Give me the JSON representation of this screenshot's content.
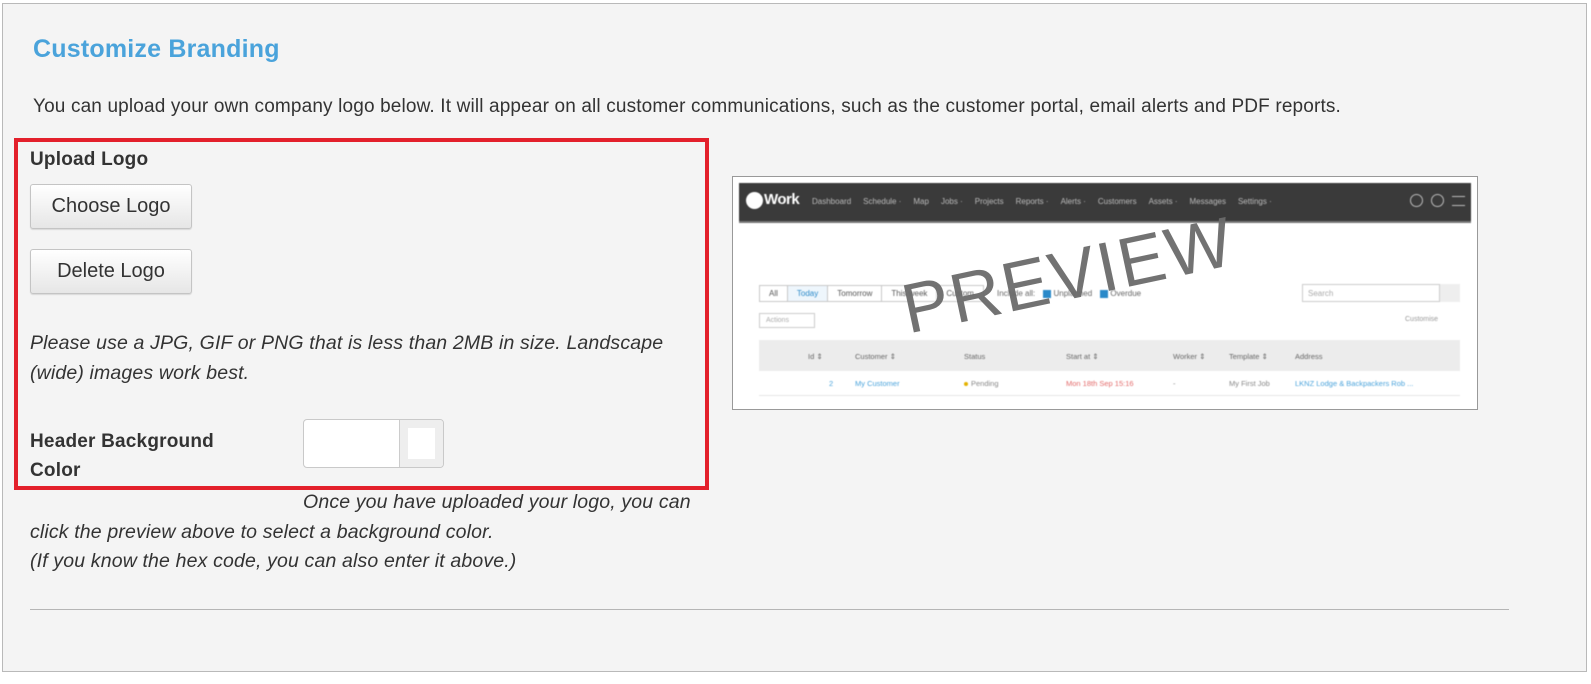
{
  "page": {
    "title": "Customize Branding",
    "intro": "You can upload your own company logo below. It will appear on all customer communications, such as the customer portal, email alerts and PDF reports."
  },
  "upload": {
    "label": "Upload Logo",
    "choose_button": "Choose Logo",
    "delete_button": "Delete Logo",
    "help": "Please use a JPG, GIF or PNG that is less than 2MB in size. Landscape (wide) images work best."
  },
  "header_color": {
    "label": "Header Background Color",
    "value": "",
    "swatch_color": "#ffffff",
    "help_line1": "Once you have uploaded your logo, you can",
    "help_line2": "click the preview above to select a background color.",
    "help_line3": "(If you know the hex code, you can also enter it above.)"
  },
  "colors": {
    "title": "#4aa3db",
    "highlight_border": "#e3202b",
    "panel_bg": "#f4f4f4",
    "nav_bg": "#3a3a3a"
  },
  "preview": {
    "watermark": "PREVIEW",
    "logo_text": "Work",
    "nav_items": [
      "Dashboard",
      "Schedule ·",
      "Map",
      "Jobs ·",
      "Projects",
      "Reports ·",
      "Alerts ·",
      "Customers",
      "Assets ·",
      "Messages",
      "Settings ·"
    ],
    "tabs": [
      "All",
      "Today",
      "Tomorrow",
      "This week",
      "Custom"
    ],
    "include_all": "Include all:",
    "include_unplanned": "Unplanned",
    "include_overdue": "Overdue",
    "search_placeholder": "Search",
    "actions": "Actions",
    "customise": "Customise",
    "columns": [
      "Id ⇕",
      "Customer ⇕",
      "Status",
      "Start at ⇕",
      "Worker ⇕",
      "Template ⇕",
      "Address"
    ],
    "row": {
      "id": "2",
      "customer": "My Customer",
      "status": "Pending",
      "start": "Mon 18th Sep 15:16",
      "worker": "-",
      "template": "My First Job",
      "address": "LKNZ Lodge & Backpackers Rob ..."
    }
  }
}
